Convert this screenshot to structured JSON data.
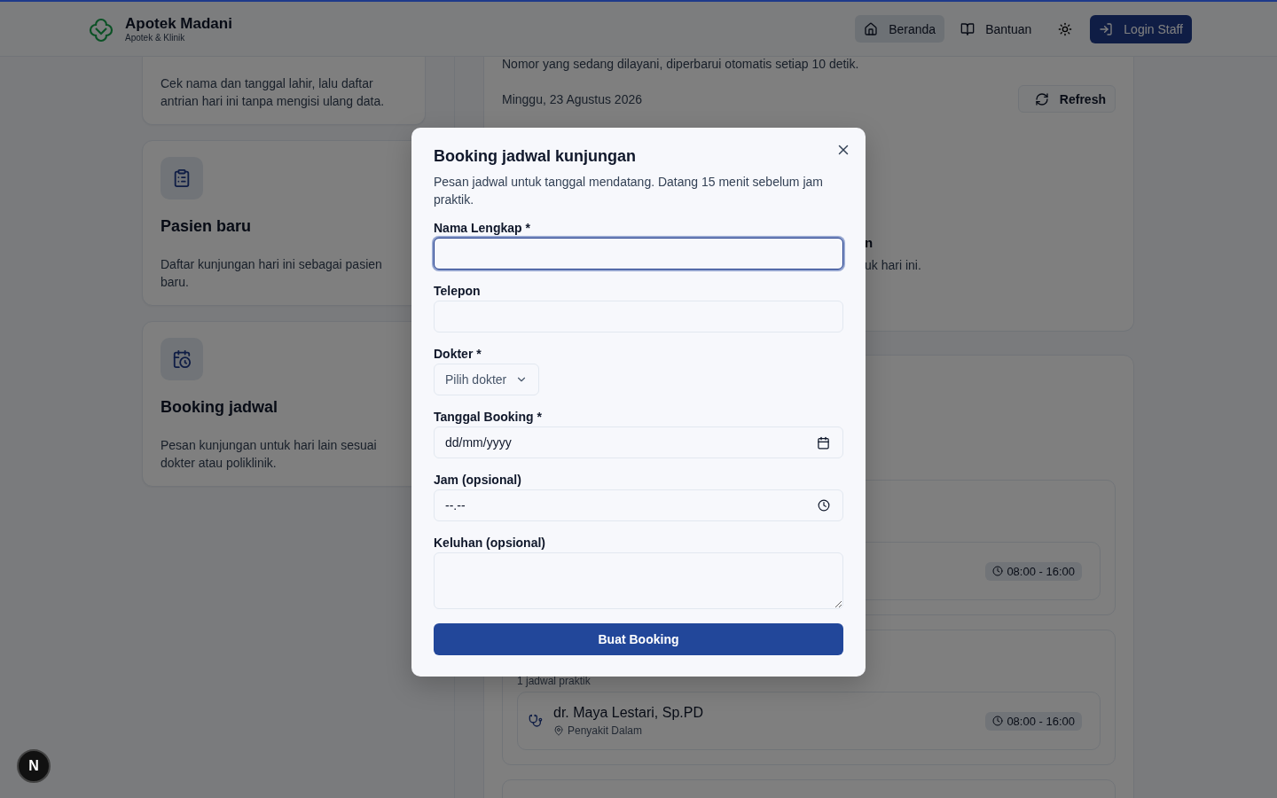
{
  "header": {
    "brand": "Apotek Madani",
    "tagline": "Apotek & Klinik",
    "nav": [
      {
        "label": "Beranda",
        "selected": true
      },
      {
        "label": "Bantuan",
        "selected": false
      }
    ],
    "login": "Login Staff"
  },
  "left_cards": [
    {
      "kind": "cut",
      "description": "Cek nama dan tanggal lahir, lalu daftar antrian hari ini tanpa mengisi ulang data."
    },
    {
      "kind": "full",
      "title": "Pasien baru",
      "description": "Daftar kunjungan hari ini sebagai pasien baru."
    },
    {
      "kind": "full",
      "title": "Booking jadwal",
      "description": "Pesan kunjungan untuk hari lain sesuai dokter atau poliklinik."
    }
  ],
  "queue_panel": {
    "description": "Nomor yang sedang dilayani, diperbarui otomatis setiap 10 detik.",
    "date": "Minggu, 23 Agustus 2026",
    "refresh": "Refresh",
    "fragment_title": "n",
    "fragment_text": "uk hari ini."
  },
  "schedule_groups": [
    {
      "kind": "group",
      "doctors": [
        {
          "time": "08:00 - 16:00"
        }
      ]
    },
    {
      "kind": "group",
      "caption": "1 jadwal praktik",
      "doctors": [
        {
          "name": "dr. Maya Lestari, Sp.PD",
          "place": "Penyakit Dalam",
          "time": "08:00 - 16:00"
        }
      ]
    },
    {
      "kind": "cut"
    }
  ],
  "modal": {
    "title": "Booking jadwal kunjungan",
    "description": "Pesan jadwal untuk tanggal mendatang. Datang 15 menit sebelum jam praktik.",
    "fields": [
      {
        "kind": "text",
        "label": "Nama Lengkap *",
        "focused": true
      },
      {
        "kind": "text",
        "label": "Telepon",
        "focused": false
      },
      {
        "kind": "select",
        "label": "Dokter *",
        "placeholder": "Pilih dokter",
        "focused": false
      },
      {
        "kind": "date",
        "label": "Tanggal Booking *",
        "placeholder": "dd/mm/yyyy",
        "focused": false
      },
      {
        "kind": "time",
        "label": "Jam (opsional)",
        "placeholder": "--.--",
        "focused": false
      },
      {
        "kind": "textarea",
        "label": "Keluhan (opsional)",
        "focused": false
      }
    ],
    "submit": "Buat Booking"
  },
  "dev_badge": "N"
}
